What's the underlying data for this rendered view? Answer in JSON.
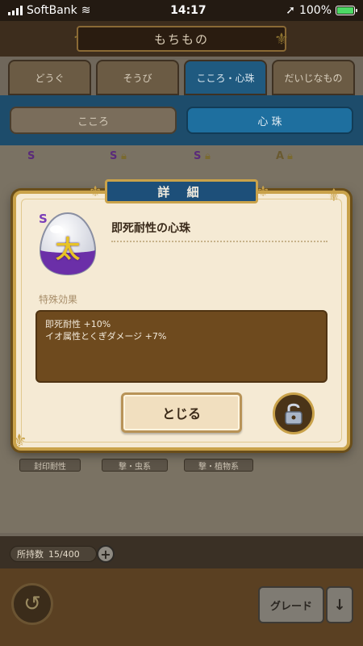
{
  "status_bar": {
    "carrier": "SoftBank",
    "time": "14:17",
    "battery": "100%"
  },
  "header": {
    "title": "もちもの"
  },
  "tabs": [
    {
      "label": "どうぐ",
      "active": false
    },
    {
      "label": "そうび",
      "active": false
    },
    {
      "label": "こころ・心珠",
      "active": true
    },
    {
      "label": "だいじなもの",
      "active": false
    }
  ],
  "subtabs": [
    {
      "label": "こころ",
      "active": false
    },
    {
      "label": "心 珠",
      "active": true
    }
  ],
  "background_items": [
    {
      "rank": "S"
    },
    {
      "rank": "S"
    },
    {
      "rank": "S"
    },
    {
      "rank": "A"
    }
  ],
  "background_labels": [
    "封印耐性",
    "撃・虫系",
    "撃・植物系"
  ],
  "inventory": {
    "label": "所持数",
    "count": "15/400"
  },
  "bottom_bar": {
    "grade_label": "グレード",
    "sort_icon": "down-arrow"
  },
  "modal": {
    "title": "詳 細",
    "item": {
      "rank": "S",
      "name": "即死耐性の心珠",
      "glyph": "太"
    },
    "section_label": "特殊効果",
    "effects": [
      "即死耐性 +10%",
      "イオ属性とくぎダメージ +7%"
    ],
    "close_label": "とじる"
  },
  "colors": {
    "accent_blue": "#1d4f79",
    "gold": "#c9a24a",
    "effect_box": "#6e4a1e",
    "orb_purple": "#6b2fa8"
  }
}
